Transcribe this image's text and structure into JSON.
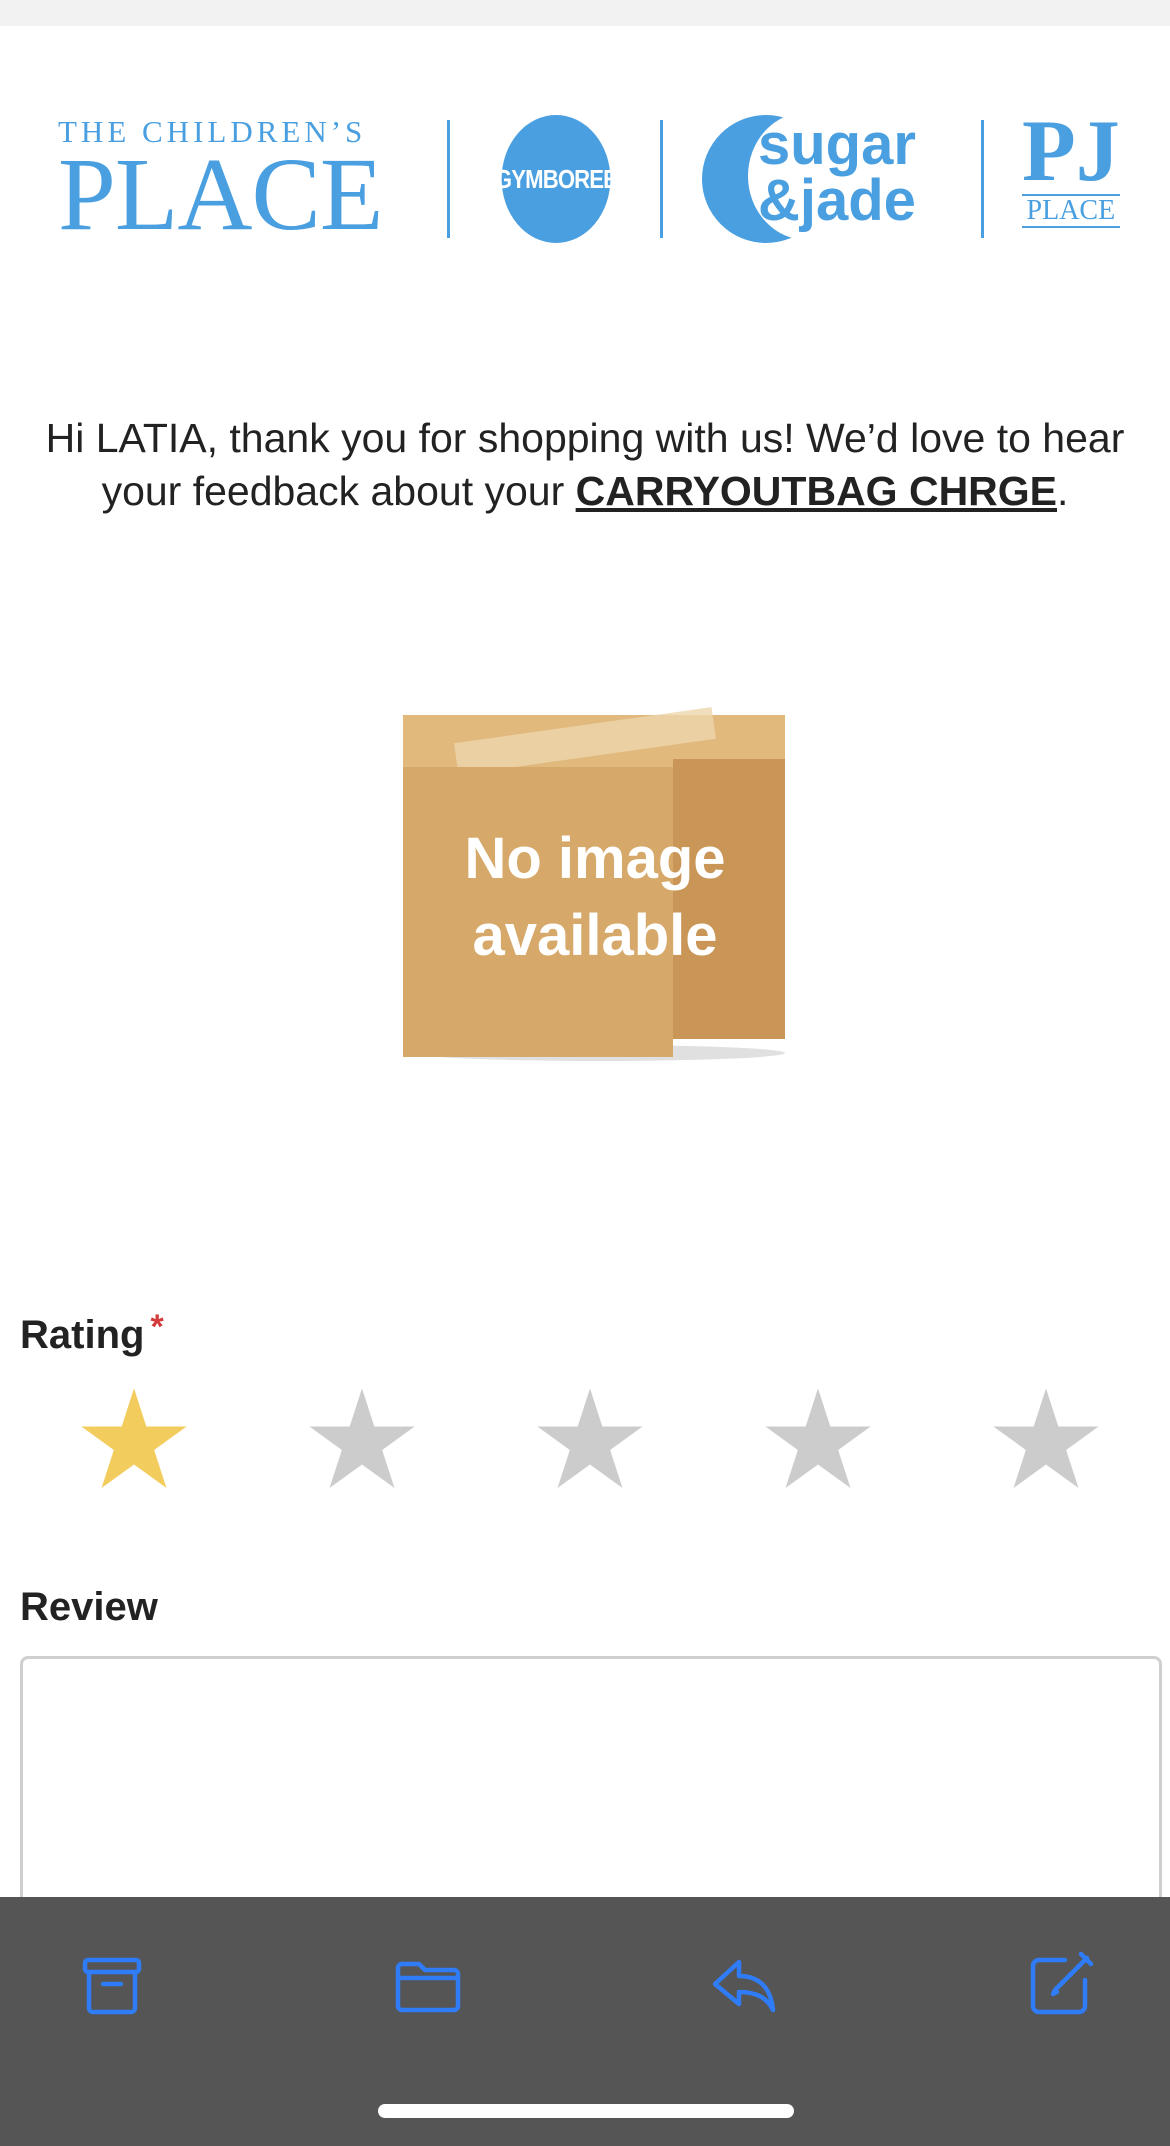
{
  "brands": {
    "tcp_line1": "THE CHILDREN’S",
    "tcp_line2": "PLACE",
    "gymboree": "GYMBOREE",
    "sugarjade_line1": "sugar",
    "sugarjade_line2": "&jade",
    "pj_line1": "PJ",
    "pj_line2": "PLACE"
  },
  "greeting": {
    "prefix": "Hi LATIA, thank you for shopping with us! We’d love to hear your feedback about your ",
    "product": "CARRYOUTBAG CHRGE",
    "suffix": "."
  },
  "product_image": {
    "line1": "No image",
    "line2": "available"
  },
  "rating": {
    "label": "Rating",
    "required_mark": "*",
    "value": 1,
    "max": 5,
    "filled_color": "#f3cc5e",
    "empty_color": "#cccccc"
  },
  "review": {
    "label": "Review",
    "value": ""
  },
  "toolbar": {
    "icons": [
      "archive-icon",
      "folder-icon",
      "reply-icon",
      "compose-icon"
    ],
    "icon_color": "#2f7cf6",
    "background": "#555555"
  }
}
